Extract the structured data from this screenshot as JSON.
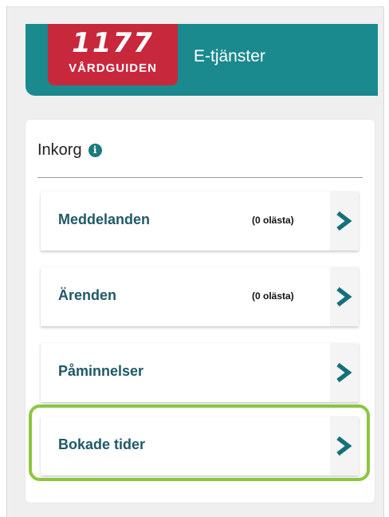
{
  "header": {
    "logo_number": "1177",
    "logo_sub": "VÅRDGUIDEN",
    "title": "E-tjänster"
  },
  "inbox": {
    "title": "Inkorg",
    "info_glyph": "i",
    "items": [
      {
        "label": "Meddelanden",
        "count": "(0 olästa)"
      },
      {
        "label": "Ärenden",
        "count": "(0 olästa)"
      },
      {
        "label": "Påminnelser",
        "count": ""
      },
      {
        "label": "Bokade tider",
        "count": ""
      }
    ]
  },
  "colors": {
    "header_teal": "#1a8a8e",
    "logo_red": "#c8283c",
    "item_text": "#1f5966",
    "chevron": "#14707a",
    "highlight_green": "#8cc63f"
  },
  "icons": {
    "info": "info-icon",
    "item_arrow": "chevron-right-icon"
  }
}
